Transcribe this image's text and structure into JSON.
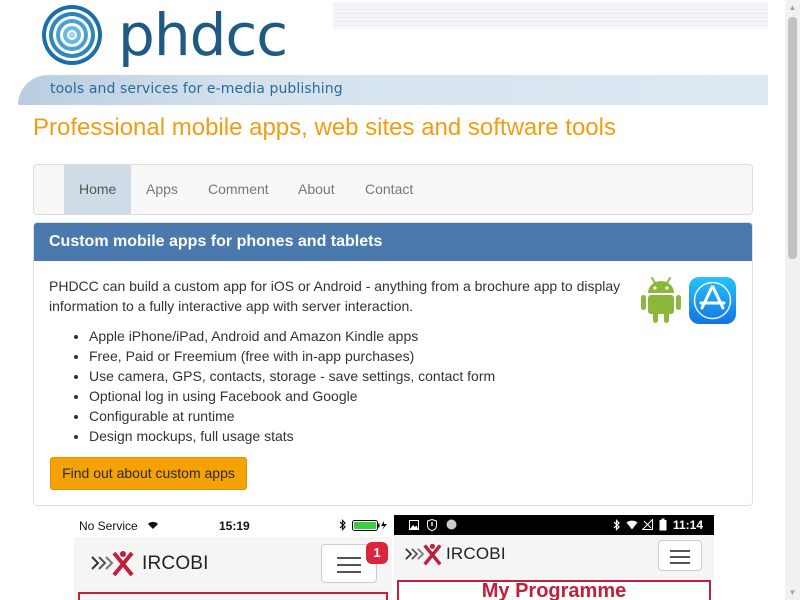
{
  "header": {
    "logo_text": "phdcc",
    "tagline": "tools and services for e-media publishing"
  },
  "page_title": "Professional mobile apps, web sites and software tools",
  "nav": {
    "items": [
      {
        "label": "Home",
        "active": true
      },
      {
        "label": "Apps",
        "active": false
      },
      {
        "label": "Comment",
        "active": false
      },
      {
        "label": "About",
        "active": false
      },
      {
        "label": "Contact",
        "active": false
      }
    ]
  },
  "panel": {
    "heading": "Custom mobile apps for phones and tablets",
    "intro": "PHDCC can build a custom app for iOS or Android - anything from a brochure app to display information to a fully interactive app with server interaction.",
    "features": [
      "Apple iPhone/iPad, Android and Amazon Kindle apps",
      "Free, Paid or Freemium (free with in-app purchases)",
      "Use camera, GPS, contacts, storage - save settings, contact form",
      "Optional log in using Facebook and Google",
      "Configurable at runtime",
      "Design mockups, full usage stats"
    ],
    "button_label": "Find out about custom apps"
  },
  "phones": {
    "ios": {
      "carrier": "No Service",
      "time": "15:19",
      "brand": "IRCOBI",
      "badge": "1"
    },
    "android": {
      "time": "11:14",
      "brand": "IRCOBI",
      "title": "My Programme"
    }
  },
  "colors": {
    "accent_orange": "#f39c12",
    "panel_blue": "#4a7aad",
    "logo_blue": "#1f5a84",
    "ircobi_red": "#c0203a",
    "button_orange": "#f5a207"
  }
}
